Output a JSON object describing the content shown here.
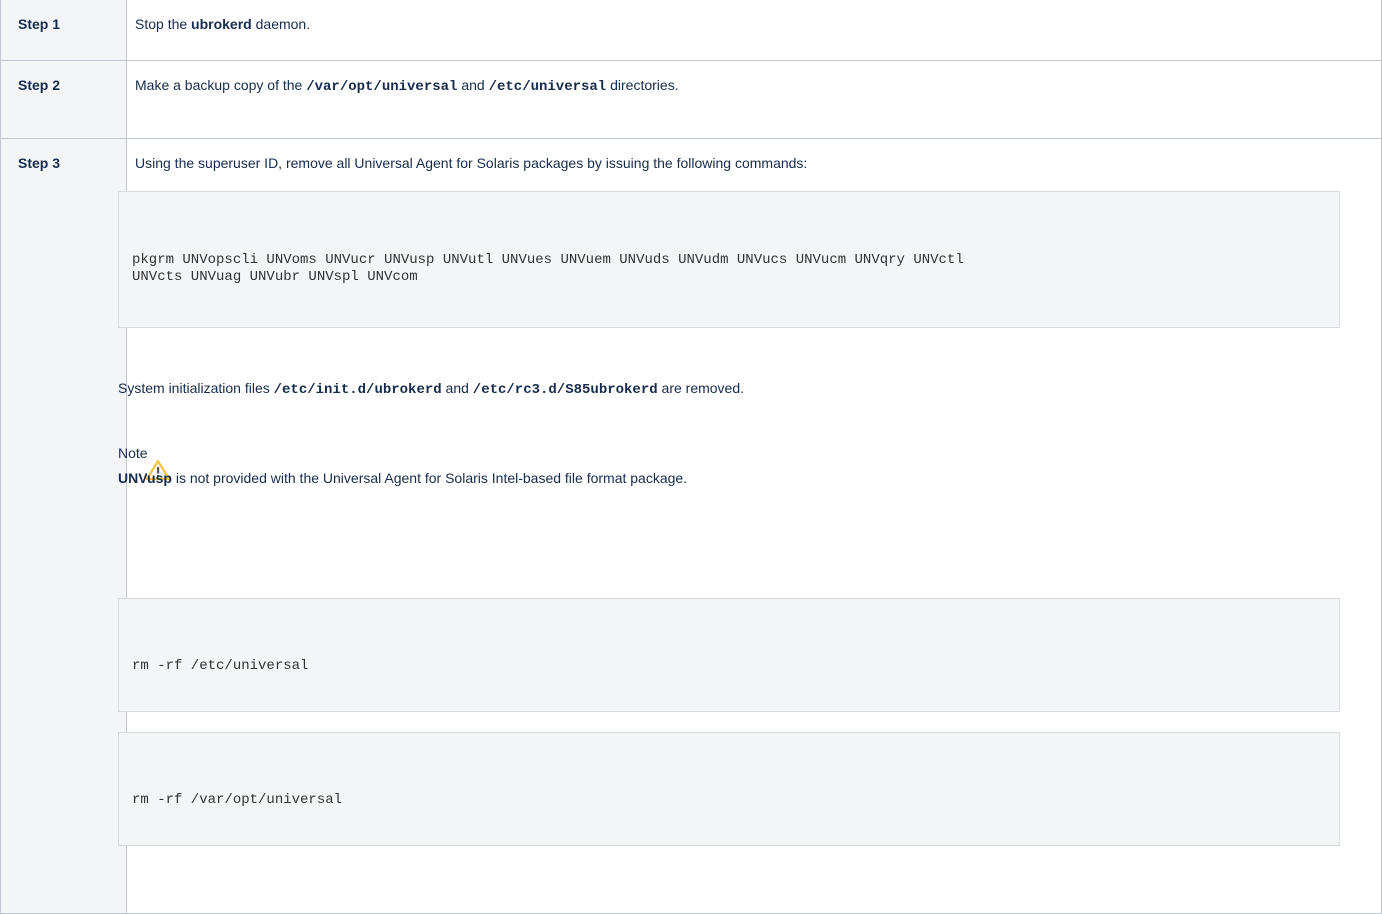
{
  "steps": [
    {
      "label": "Step 1",
      "parts": {
        "t1": "Stop the ",
        "b1": "ubrokerd",
        "t2": " daemon."
      }
    },
    {
      "label": "Step 2",
      "parts": {
        "t1": "Make a backup copy of the ",
        "c1": "/var/opt/universal",
        "t2": " and ",
        "c2": "/etc/universal",
        "t3": " directories."
      }
    },
    {
      "label": "Step 3",
      "intro": "Using the superuser ID, remove all Universal Agent for Solaris packages by issuing the following commands:",
      "command1_line1": "pkgrm UNVopscli UNVoms UNVucr UNVusp UNVutl UNVues UNVuem UNVuds UNVudm UNVucs UNVucm UNVqry UNVctl",
      "command1_line2": "UNVcts UNVuag UNVubr UNVspl UNVcom",
      "init_parts": {
        "t1": "System initialization files ",
        "c1": "/etc/init.d/ubrokerd",
        "t2": " and ",
        "c2": "/etc/rc3.d/S85ubrokerd",
        "t3": " are removed."
      },
      "note": {
        "title": "Note",
        "icon": "warning-icon",
        "b1": "UNVusp",
        "t1": " is not provided with the Universal Agent for Solaris Intel-based file format package."
      },
      "command2": "rm -rf /etc/universal",
      "command3": "rm -rf /var/opt/universal"
    }
  ],
  "colors": {
    "header_bg": "#f4f5f7",
    "border": "#c1c7d0",
    "code_bg": "#f4f5f7",
    "warning": "#f6c342"
  }
}
